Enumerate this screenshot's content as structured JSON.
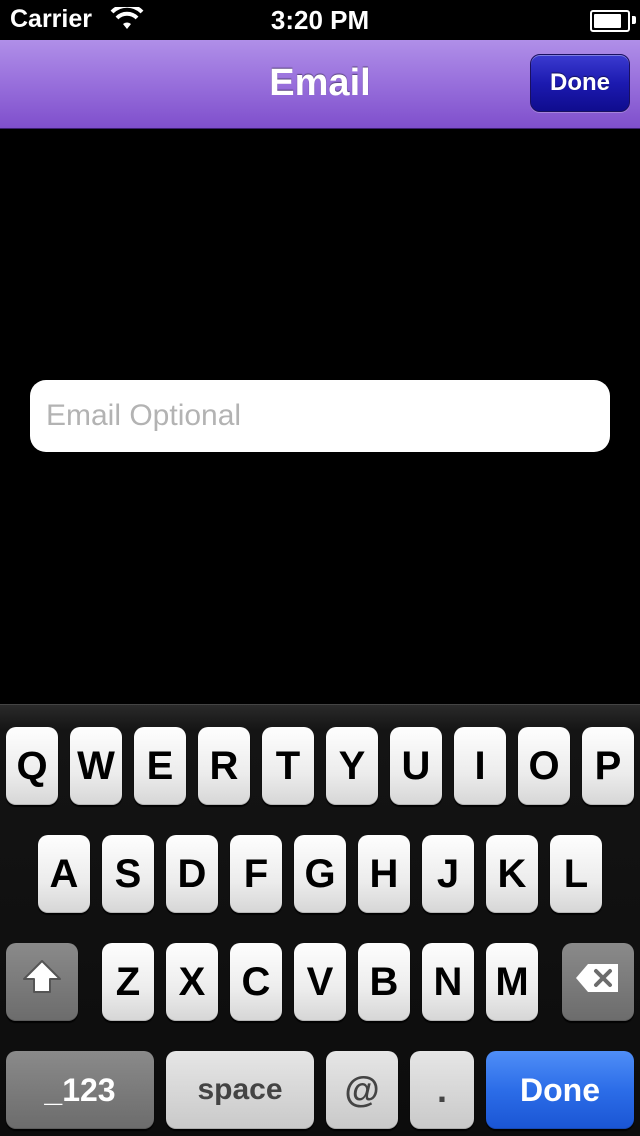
{
  "status_bar": {
    "carrier": "Carrier",
    "time": "3:20 PM",
    "battery_level": 0.9
  },
  "nav": {
    "title": "Email",
    "done_label": "Done",
    "bar_color": "#9a72dd",
    "done_color": "#1c1ab0"
  },
  "form": {
    "email_placeholder": "Email Optional",
    "email_value": ""
  },
  "keyboard": {
    "row1": [
      "Q",
      "W",
      "E",
      "R",
      "T",
      "Y",
      "U",
      "I",
      "O",
      "P"
    ],
    "row2": [
      "A",
      "S",
      "D",
      "F",
      "G",
      "H",
      "J",
      "K",
      "L"
    ],
    "row3": [
      "Z",
      "X",
      "C",
      "V",
      "B",
      "N",
      "M"
    ],
    "shift_icon": "shift-arrow-icon",
    "delete_icon": "backspace-icon",
    "numbers_label": "_123",
    "space_label": "space",
    "at_label": "@",
    "dot_label": ".",
    "done_label": "Done",
    "done_color": "#2c6de8"
  }
}
